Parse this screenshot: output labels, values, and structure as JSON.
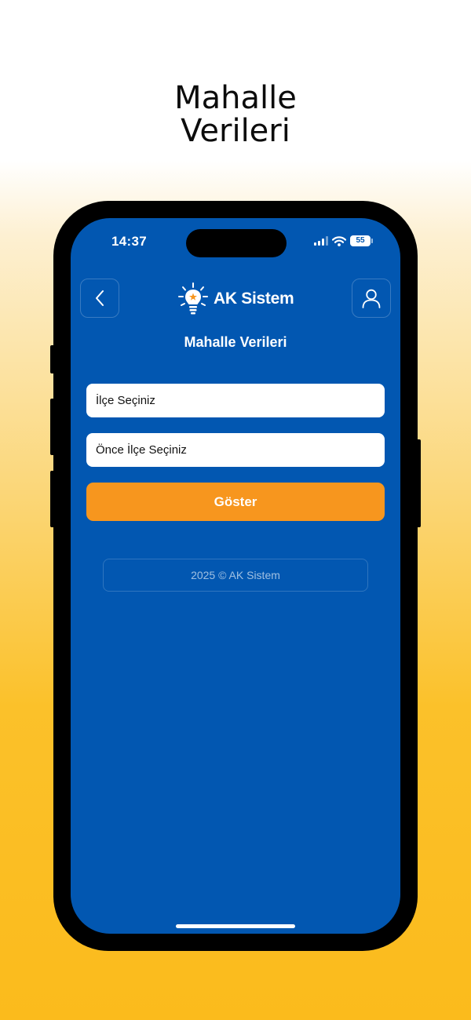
{
  "promo": {
    "title_line1": "Mahalle",
    "title_line2": "Verileri"
  },
  "status_bar": {
    "time": "14:37",
    "battery": "55"
  },
  "header": {
    "brand": "AK Sistem",
    "back_icon": "chevron-left-icon",
    "profile_icon": "user-icon",
    "logo_icon": "lightbulb-icon"
  },
  "page": {
    "title": "Mahalle Verileri"
  },
  "form": {
    "district_select": "İlçe Seçiniz",
    "neighborhood_select": "Önce İlçe Seçiniz",
    "submit_label": "Göster"
  },
  "footer": {
    "text": "2025 © AK Sistem"
  },
  "colors": {
    "screen_background": "#0257b1",
    "button_accent": "#f7961e",
    "page_gradient_bottom": "#fbbb1c"
  }
}
